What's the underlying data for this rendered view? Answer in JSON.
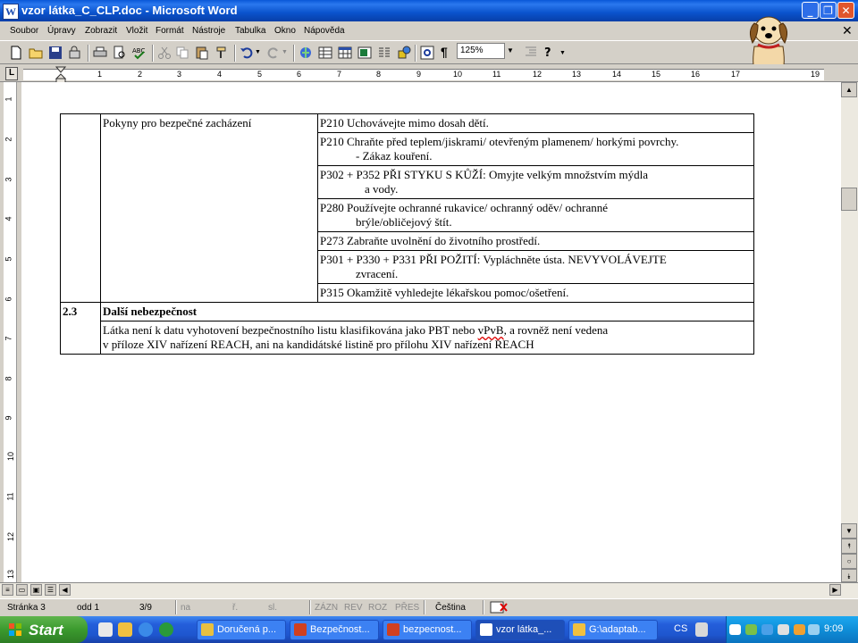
{
  "window": {
    "title": "vzor látka_C_CLP.doc - Microsoft Word",
    "icon": "word-icon"
  },
  "menu": [
    "Soubor",
    "Úpravy",
    "Zobrazit",
    "Vložit",
    "Formát",
    "Nástroje",
    "Tabulka",
    "Okno",
    "Nápověda"
  ],
  "toolbar": {
    "zoom": "125%"
  },
  "ruler": {
    "numbers": [
      "1",
      "2",
      "3",
      "4",
      "5",
      "6",
      "7",
      "8",
      "9",
      "10",
      "11",
      "12",
      "13",
      "14",
      "15",
      "16",
      "17",
      "19"
    ]
  },
  "vruler": {
    "numbers": [
      "1",
      "2",
      "3",
      "4",
      "5",
      "6",
      "7",
      "8",
      "9",
      "10",
      "11",
      "12",
      "13"
    ]
  },
  "table": {
    "row1_label": "Pokyny pro bezpečné zacházení",
    "p_rows": [
      {
        "code": "P210",
        "l1": "Uchovávejte mimo dosah dětí.",
        "l2": ""
      },
      {
        "code": "P210",
        "l1": "Chraňte před teplem/jiskrami/ otevřeným plamenem/ horkými povrchy.",
        "l2": "- Zákaz kouření."
      },
      {
        "code": "P302 + P352",
        "l1": "PŘI STYKU S KŮŽÍ: Omyjte velkým množstvím mýdla",
        "l2": "a vody."
      },
      {
        "code": "P280",
        "l1": "Používejte ochranné rukavice/ ochranný oděv/ ochranné",
        "l2": "brýle/obličejový štít."
      },
      {
        "code": "P273",
        "l1": "Zabraňte uvolnění do životního prostředí.",
        "l2": ""
      },
      {
        "code": "P301 + P330 + P331",
        "l1": "PŘI POŽITÍ: Vypláchněte ústa. NEVYVOLÁVEJTE",
        "l2": "zvracení."
      },
      {
        "code": "P315",
        "l1": "Okamžitě vyhledejte lékařskou pomoc/ošetření.",
        "l2": ""
      }
    ],
    "section_num": "2.3",
    "section_title": "Další nebezpečnost",
    "section_text_a": "Látka není k datu vyhotovení bezpečnostního listu klasifikována jako PBT nebo ",
    "section_text_vpvb": "vPvB",
    "section_text_b": ", a rovněž není vedena",
    "section_text_2": "v příloze XIV nařízení REACH, ani na kandidátské listině pro přílohu XIV nařízení REACH"
  },
  "status": {
    "page": "Stránka 3",
    "section": "odd 1",
    "pages": "3/9",
    "at": "na",
    "line": "ř.",
    "col": "sl.",
    "rec": "ZÁZN",
    "rev": "REV",
    "ext": "ROZ",
    "ovr": "PŘES",
    "language": "Čeština"
  },
  "taskbar": {
    "start": "Start",
    "tasks": [
      "Doručená p...",
      "Bezpečnost...",
      "bezpecnost...",
      "vzor látka_...",
      "G:\\adaptab..."
    ],
    "lang": "CS",
    "clock": "9:09"
  }
}
